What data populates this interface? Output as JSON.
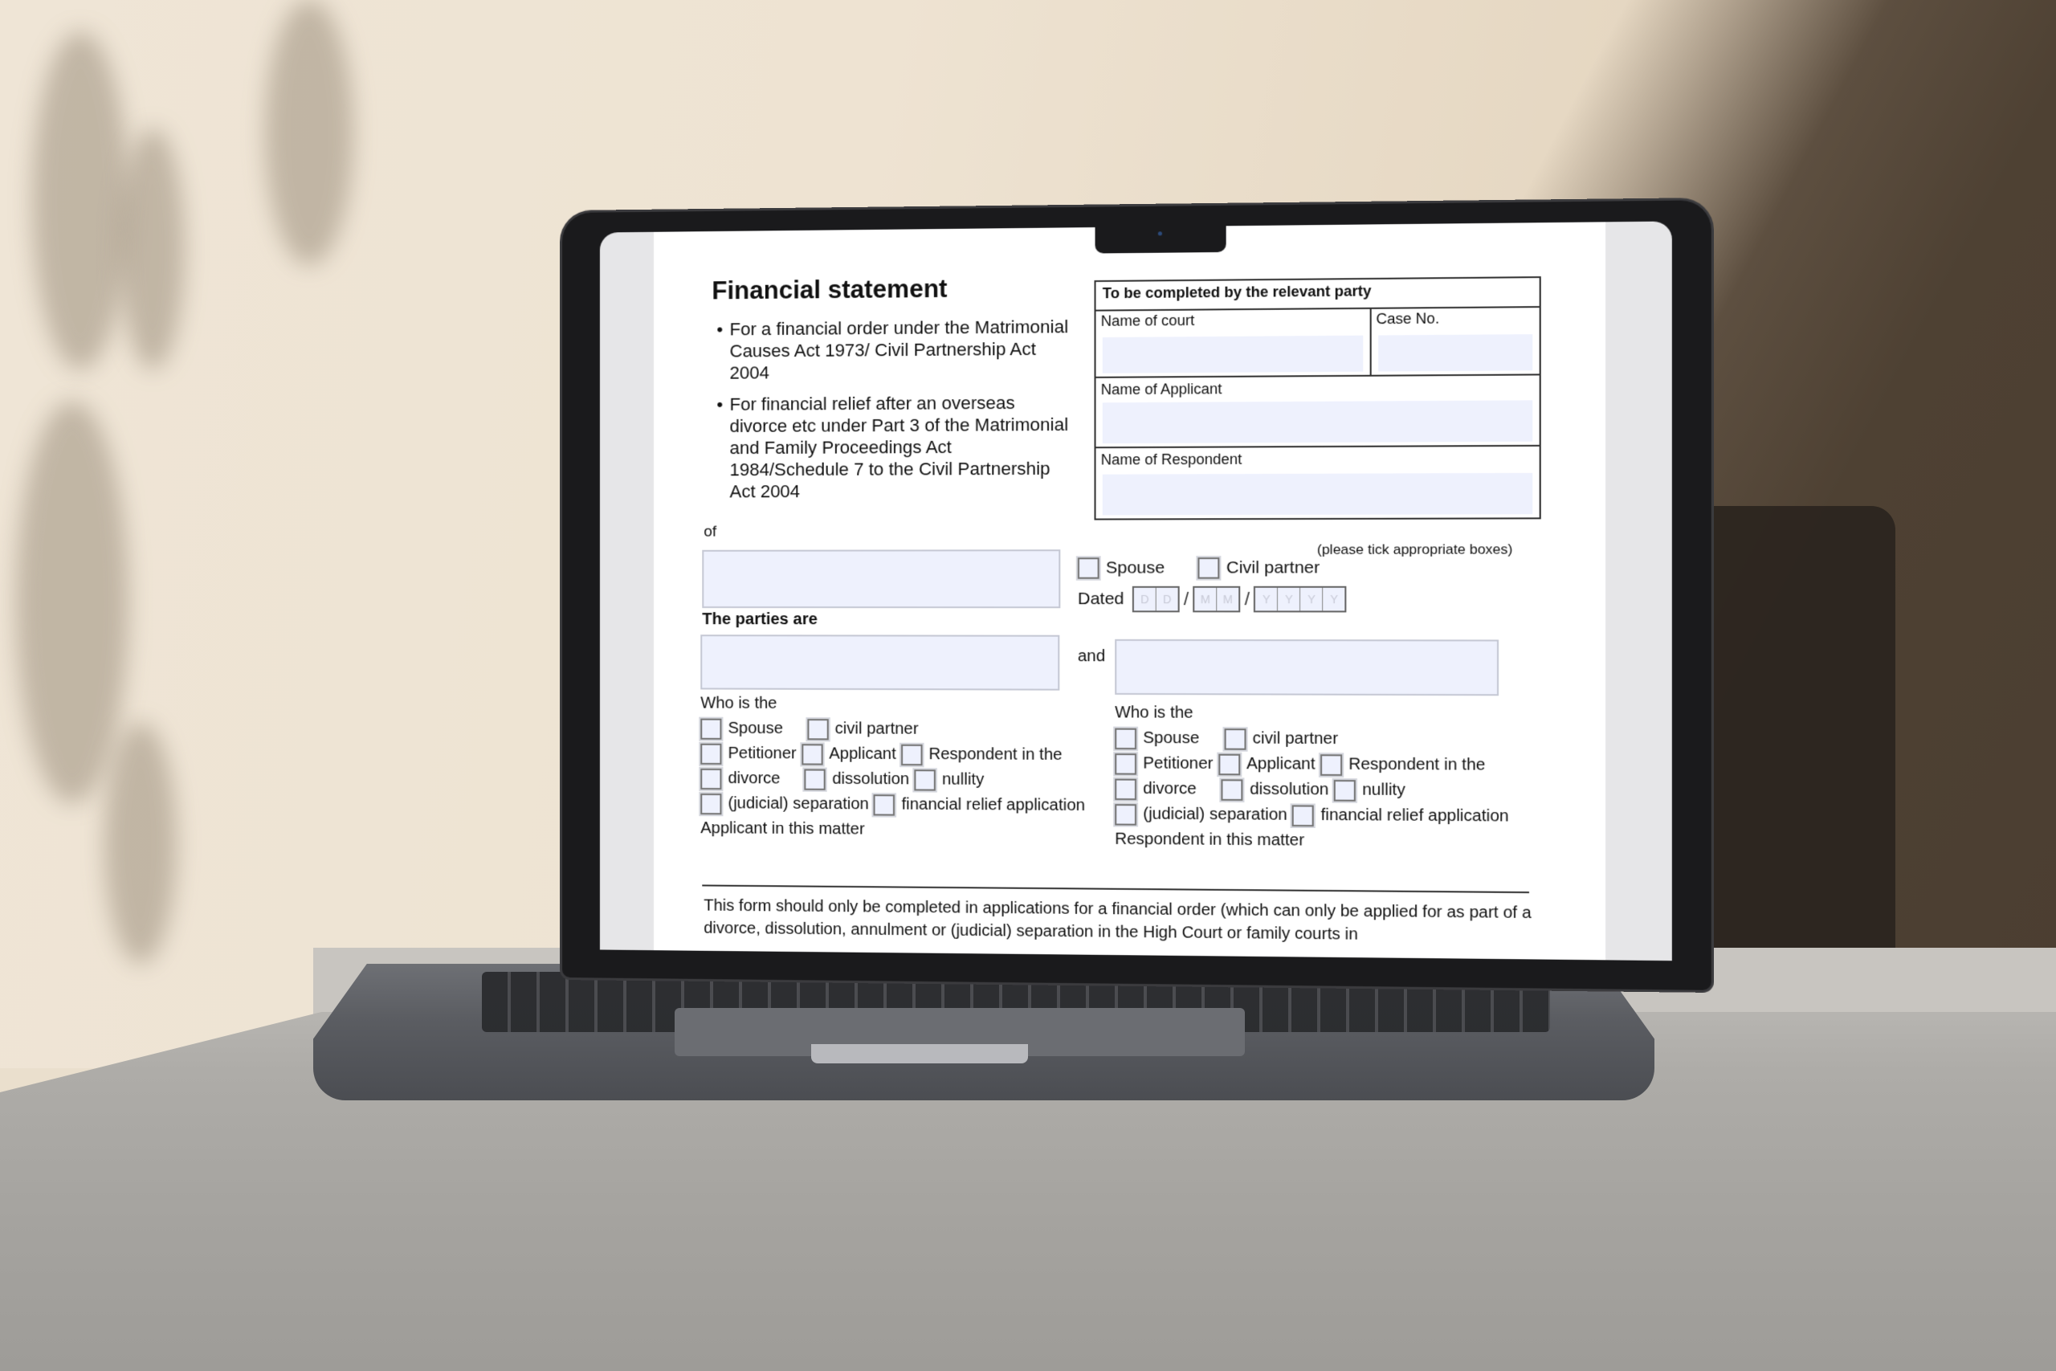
{
  "scene": {
    "description": "Laptop on stone table displaying a PDF form",
    "colors": {
      "wall": "#eee3d2",
      "shadow": "#4e4133",
      "table": "#aeaca8",
      "laptop": "#5b5d62",
      "field_fill": "#eef1fd"
    }
  },
  "form": {
    "title": "Financial statement",
    "bullets": [
      "For a financial order under the Matrimonial Causes Act 1973/ Civil Partnership Act 2004",
      "For financial relief after an overseas divorce etc under Part 3 of the Matrimonial and Family Proceedings Act 1984/Schedule 7 to the Civil Partnership Act 2004"
    ],
    "court_box": {
      "heading": "To be completed by the relevant party",
      "name_of_court_label": "Name of court",
      "name_of_court_value": "",
      "case_no_label": "Case No.",
      "case_no_value": "",
      "applicant_label": "Name of Applicant",
      "applicant_value": "",
      "respondent_label": "Name of Respondent",
      "respondent_value": ""
    },
    "of_label": "of",
    "of_value": "",
    "tick_note": "(please tick appropriate boxes)",
    "relation_options": [
      "Spouse",
      "Civil partner"
    ],
    "dated_label": "Dated",
    "date_placeholders": {
      "day": [
        "D",
        "D"
      ],
      "month": [
        "M",
        "M"
      ],
      "year": [
        "Y",
        "Y",
        "Y",
        "Y"
      ],
      "separator": "/"
    },
    "parties_label": "The parties are",
    "and_label": "and",
    "applicant_party": {
      "value": "",
      "who_is_the": "Who is the",
      "lines": [
        [
          "Spouse",
          "civil partner"
        ],
        [
          "Petitioner",
          "Applicant",
          "Respondent in the"
        ],
        [
          "divorce",
          "dissolution",
          "nullity"
        ],
        [
          "(judicial) separation",
          "financial relief application"
        ]
      ],
      "footer": "Applicant in this matter"
    },
    "respondent_party": {
      "value": "",
      "who_is_the": "Who is the",
      "lines": [
        [
          "Spouse",
          "civil partner"
        ],
        [
          "Petitioner",
          "Applicant",
          "Respondent in the"
        ],
        [
          "divorce",
          "dissolution",
          "nullity"
        ],
        [
          "(judicial) separation",
          "financial relief application"
        ]
      ],
      "footer": "Respondent in this matter"
    },
    "footer_text": "This form should only be completed in applications for a financial order (which can only be applied for as part of a divorce, dissolution, annulment or (judicial) separation in the High Court or family courts in"
  }
}
